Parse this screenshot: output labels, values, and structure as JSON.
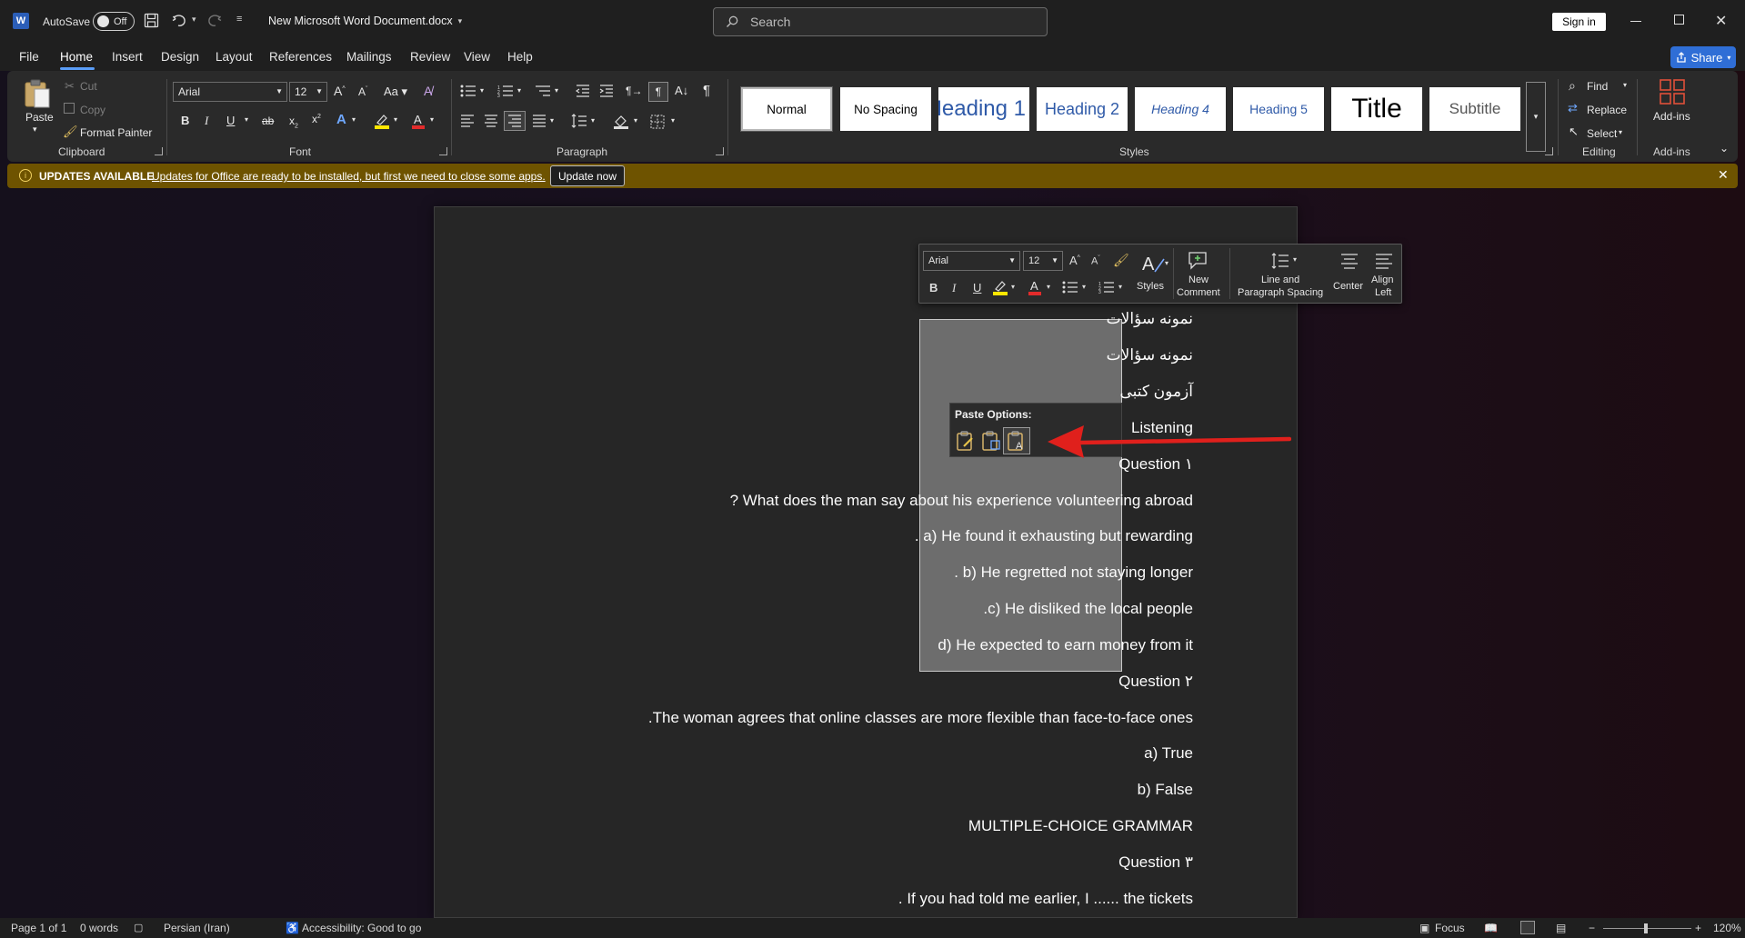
{
  "titlebar": {
    "autosave_label": "AutoSave",
    "autosave_state": "Off",
    "doc_title": "New Microsoft Word Document.docx",
    "search_placeholder": "Search",
    "signin": "Sign in"
  },
  "menu": {
    "items": [
      "File",
      "Home",
      "Insert",
      "Design",
      "Layout",
      "References",
      "Mailings",
      "Review",
      "View",
      "Help"
    ],
    "share": "Share"
  },
  "ribbon": {
    "clipboard": {
      "paste": "Paste",
      "cut": "Cut",
      "copy": "Copy",
      "format_painter": "Format Painter",
      "label": "Clipboard"
    },
    "font": {
      "name": "Arial",
      "size": "12",
      "label": "Font"
    },
    "paragraph": {
      "label": "Paragraph"
    },
    "styles": {
      "items": [
        "Normal",
        "No Spacing",
        "Heading 1",
        "Heading 2",
        "Heading 4",
        "Heading 5",
        "Title",
        "Subtitle"
      ],
      "label": "Styles"
    },
    "editing": {
      "find": "Find",
      "replace": "Replace",
      "select": "Select",
      "label": "Editing"
    },
    "addins": {
      "button": "Add-ins",
      "label": "Add-ins"
    }
  },
  "update_bar": {
    "title": "UPDATES AVAILABLE",
    "message": "Updates for Office are ready to be installed, but first we need to close some apps.",
    "button": "Update now"
  },
  "mini_toolbar": {
    "font": "Arial",
    "size": "12",
    "styles": "Styles",
    "new_comment_1": "New",
    "new_comment_2": "Comment",
    "line_spacing_1": "Line and",
    "line_spacing_2": "Paragraph Spacing",
    "center": "Center",
    "align_left_1": "Align",
    "align_left_2": "Left"
  },
  "paste_options": {
    "title": "Paste Options:"
  },
  "document": {
    "lines": [
      "نمونه سؤالات",
      "نمونه سؤالات",
      "آزمون کتبی",
      "Listening",
      "Question ۱",
      "? What does the man say about his experience volunteering abroad",
      ". a) He found it exhausting but rewarding",
      ". b) He regretted not staying longer",
      ".c) He disliked the local people",
      "d) He expected to earn money from it",
      "Question ۲",
      ".The woman agrees that online classes are more flexible than face-to-face ones",
      "a) True",
      "b) False",
      "MULTIPLE-CHOICE GRAMMAR",
      "Question ۳",
      ". If you had told me earlier, I ...... the tickets"
    ]
  },
  "statusbar": {
    "page": "Page 1 of 1",
    "words": "0 words",
    "language": "Persian (Iran)",
    "accessibility": "Accessibility: Good to go",
    "focus": "Focus",
    "zoom": "120%"
  },
  "colors": {
    "accent": "#2f6ed6",
    "update_bar": "#6e5300",
    "arrow": "#e0201c",
    "heading_blue": "#2f5aa8"
  }
}
